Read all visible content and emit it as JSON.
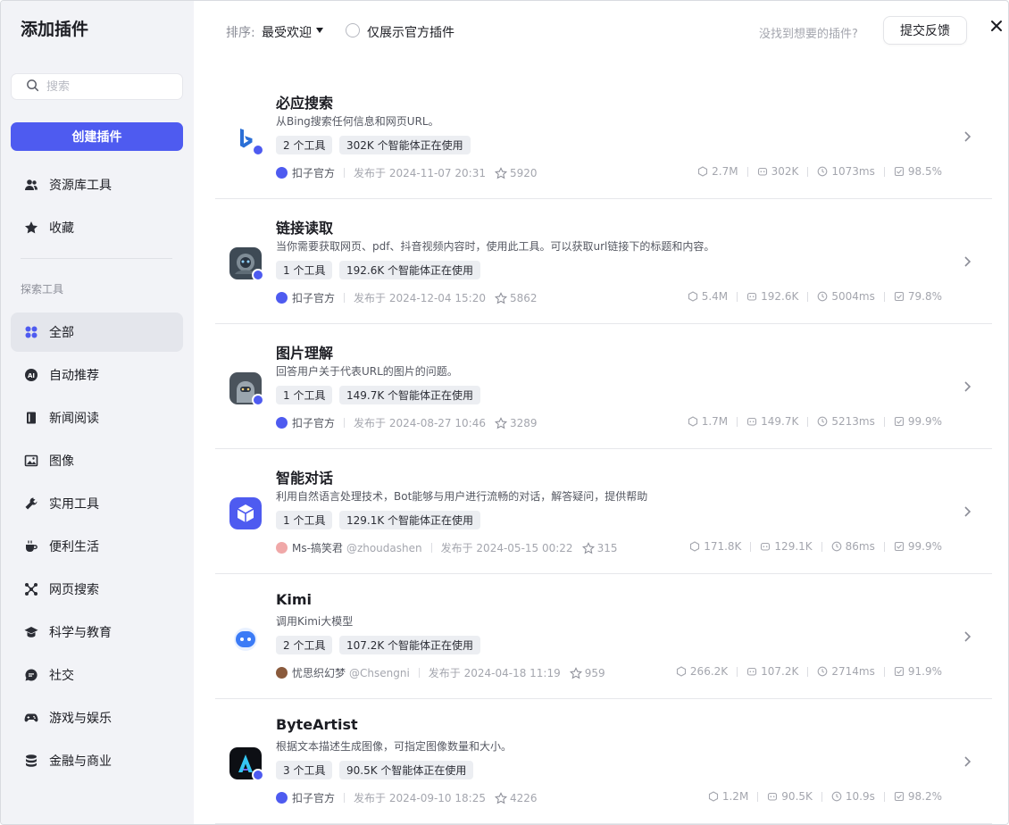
{
  "sidebar": {
    "title": "添加插件",
    "search_placeholder": "搜索",
    "create_label": "创建插件",
    "top_items": [
      {
        "label": "资源库工具",
        "icon": "users-icon"
      },
      {
        "label": "收藏",
        "icon": "star-icon"
      }
    ],
    "section_label": "探索工具",
    "categories": [
      {
        "label": "全部",
        "icon": "grid-icon",
        "active": true
      },
      {
        "label": "自动推荐",
        "icon": "ai-icon"
      },
      {
        "label": "新闻阅读",
        "icon": "book-icon"
      },
      {
        "label": "图像",
        "icon": "image-icon"
      },
      {
        "label": "实用工具",
        "icon": "wrench-icon"
      },
      {
        "label": "便利生活",
        "icon": "coffee-icon"
      },
      {
        "label": "网页搜索",
        "icon": "network-icon"
      },
      {
        "label": "科学与教育",
        "icon": "graduation-cap-icon"
      },
      {
        "label": "社交",
        "icon": "chat-icon"
      },
      {
        "label": "游戏与娱乐",
        "icon": "gamepad-icon"
      },
      {
        "label": "金融与商业",
        "icon": "coins-icon"
      }
    ]
  },
  "toolbar": {
    "sort_label": "排序:",
    "sort_value": "最受欢迎",
    "official_only_label": "仅展示官方插件",
    "not_found_text": "没找到想要的插件?",
    "feedback_label": "提交反馈"
  },
  "plugins": [
    {
      "name": "必应搜索",
      "desc": "从Bing搜索任何信息和网页URL。",
      "tool_count": "2 个工具",
      "usage": "302K 个智能体正在使用",
      "author": "扣子官方",
      "handle": "",
      "published": "发布于 2024-11-07 20:31",
      "stars": "5920",
      "stat1": "2.7M",
      "stat2": "302K",
      "stat3": "1073ms",
      "stat4": "98.5%",
      "icon": "bing-icon",
      "official": true
    },
    {
      "name": "链接读取",
      "desc": "当你需要获取网页、pdf、抖音视频内容时，使用此工具。可以获取url链接下的标题和内容。",
      "tool_count": "1 个工具",
      "usage": "192.6K 个智能体正在使用",
      "author": "扣子官方",
      "handle": "",
      "published": "发布于 2024-12-04 15:20",
      "stars": "5862",
      "stat1": "5.4M",
      "stat2": "192.6K",
      "stat3": "5004ms",
      "stat4": "79.8%",
      "icon": "robot-image-icon",
      "official": true
    },
    {
      "name": "图片理解",
      "desc": "回答用户关于代表URL的图片的问题。",
      "tool_count": "1 个工具",
      "usage": "149.7K 个智能体正在使用",
      "author": "扣子官方",
      "handle": "",
      "published": "发布于 2024-08-27 10:46",
      "stars": "3289",
      "stat1": "1.7M",
      "stat2": "149.7K",
      "stat3": "5213ms",
      "stat4": "99.9%",
      "icon": "robot-image-icon",
      "official": true
    },
    {
      "name": "智能对话",
      "desc": "利用自然语言处理技术，Bot能够与用户进行流畅的对话，解答疑问，提供帮助",
      "tool_count": "1 个工具",
      "usage": "129.1K 个智能体正在使用",
      "author": "Ms-搞笑君",
      "handle": "@zhoudashen",
      "published": "发布于 2024-05-15 00:22",
      "stars": "315",
      "stat1": "171.8K",
      "stat2": "129.1K",
      "stat3": "86ms",
      "stat4": "99.9%",
      "icon": "cube-icon",
      "official": false
    },
    {
      "name": "Kimi",
      "desc": "调用Kimi大模型",
      "tool_count": "2 个工具",
      "usage": "107.2K 个智能体正在使用",
      "author": "忧思织幻梦",
      "handle": "@Chsengni",
      "published": "发布于 2024-04-18 11:19",
      "stars": "959",
      "stat1": "266.2K",
      "stat2": "107.2K",
      "stat3": "2714ms",
      "stat4": "91.9%",
      "icon": "bot-face-icon",
      "official": false
    },
    {
      "name": "ByteArtist",
      "desc": "根据文本描述生成图像，可指定图像数量和大小。",
      "tool_count": "3 个工具",
      "usage": "90.5K 个智能体正在使用",
      "author": "扣子官方",
      "handle": "",
      "published": "发布于 2024-09-10 18:25",
      "stars": "4226",
      "stat1": "1.2M",
      "stat2": "90.5K",
      "stat3": "10.9s",
      "stat4": "98.2%",
      "icon": "byteartist-icon",
      "official": true
    }
  ],
  "colors": {
    "accent": "#4e5bf0",
    "sidebar_bg": "#f2f3f7"
  }
}
